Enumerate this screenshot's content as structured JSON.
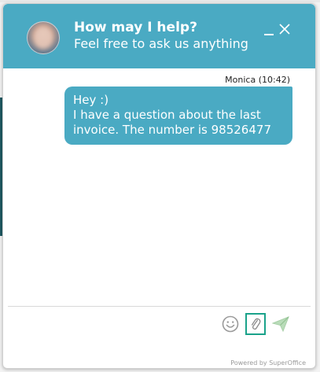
{
  "header": {
    "title": "How may I help?",
    "subtitle": "Feel free to ask us anything",
    "minimize_icon": "minimize-icon",
    "close_icon": "close-icon",
    "color": "#4aaac3"
  },
  "conversation": {
    "messages": [
      {
        "sender": "Monica",
        "time": "10:42",
        "meta": "Monica (10:42)",
        "text": "Hey :)\nI have a question about the last invoice. The number is 98526477"
      }
    ]
  },
  "composer": {
    "input_value": "",
    "emoji_icon": "smiley-icon",
    "attach_icon": "paperclip-icon",
    "send_icon": "paper-plane-icon",
    "focus_color": "#1aa28a"
  },
  "footer": {
    "powered_by": "Powered by SuperOffice"
  }
}
